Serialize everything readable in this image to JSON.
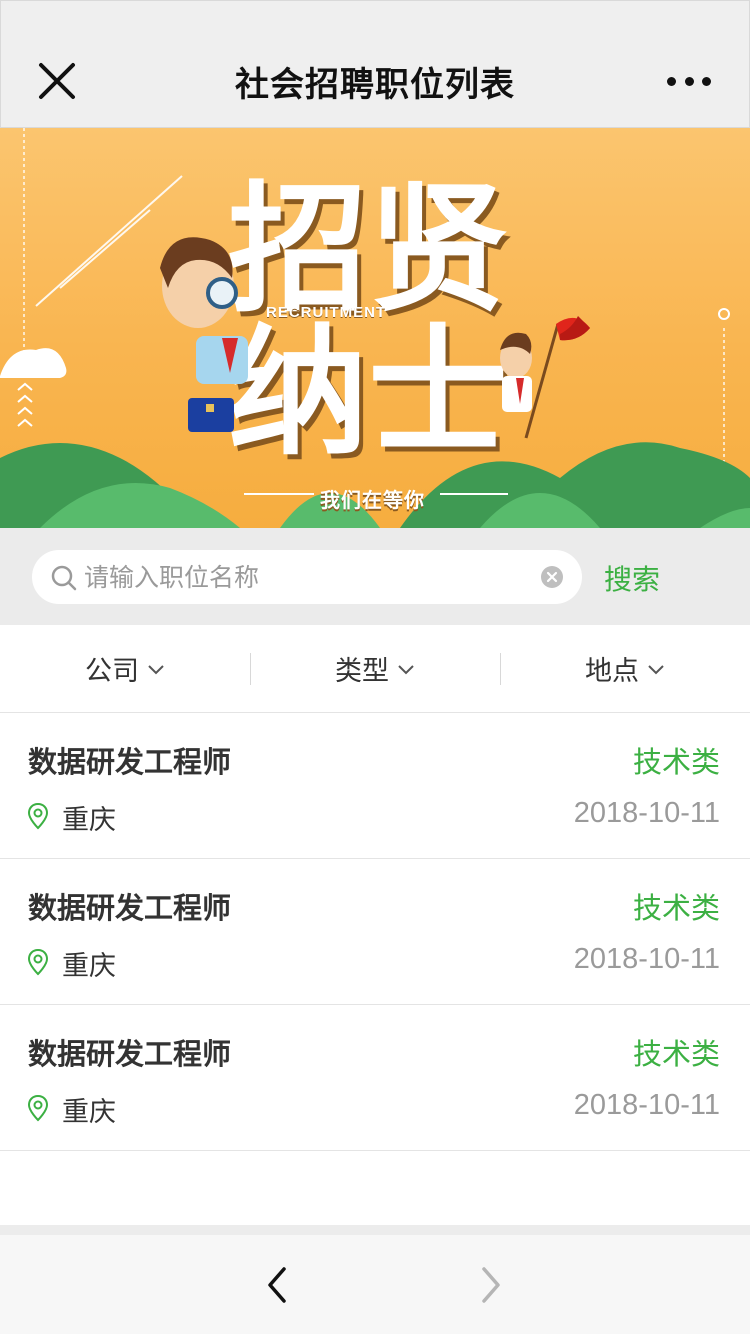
{
  "header": {
    "title": "社会招聘职位列表",
    "close_icon": "close-icon",
    "more_icon": "more-dots-icon"
  },
  "banner": {
    "headline": "招贤纳士",
    "subtitle_en": "RECRUITMENT",
    "slogan": "我们在等你"
  },
  "search": {
    "placeholder": "请输入职位名称",
    "value": "",
    "button_label": "搜索"
  },
  "filters": [
    {
      "label": "公司"
    },
    {
      "label": "类型"
    },
    {
      "label": "地点"
    }
  ],
  "jobs": [
    {
      "title": "数据研发工程师",
      "type": "技术类",
      "location": "重庆",
      "date": "2018-10-11"
    },
    {
      "title": "数据研发工程师",
      "type": "技术类",
      "location": "重庆",
      "date": "2018-10-11"
    },
    {
      "title": "数据研发工程师",
      "type": "技术类",
      "location": "重庆",
      "date": "2018-10-11"
    }
  ],
  "colors": {
    "accent_green": "#3cb043",
    "banner_orange": "#f9b550",
    "header_bg": "#efefef"
  },
  "nav": {
    "back_icon": "chevron-left-icon",
    "forward_icon": "chevron-right-icon"
  }
}
